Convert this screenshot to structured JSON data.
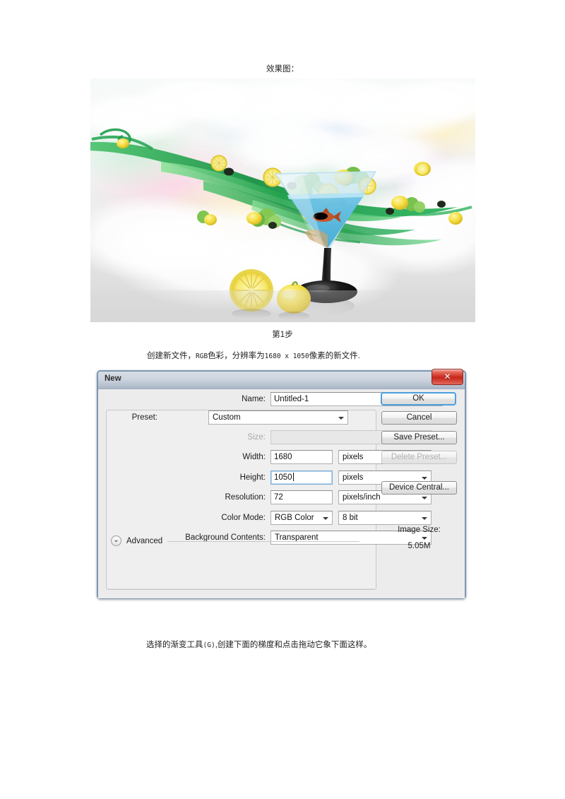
{
  "document": {
    "result_caption": "效果图：",
    "step_heading": "第1步",
    "step1_text_a": "创建新文件，",
    "step1_text_b": "RGB",
    "step1_text_c": "色彩，分辨率为",
    "step1_text_d": "1680 x 1050",
    "step1_text_e": "像素的新文件.",
    "step2_text_a": "选择的渐变工具",
    "step2_text_b": "(G)",
    "step2_text_c": ",创建下面的梯度和点击拖动它象下面这样。"
  },
  "artwork": {
    "alt": "抽象马提尼酒杯合成图：绿色丝带、柠檬片、生菜、金鱼在杯中，云彩与彩虹背景",
    "background_top": "#f7f9f8",
    "background_bottom": "#dddddd",
    "ribbon_color": "#189e4a",
    "lemon_color": "#f2e34a",
    "fish_color": "#c4562a",
    "glass_water": "#79c7e6"
  },
  "dialog": {
    "title": "New",
    "close_glyph": "✕",
    "fields": {
      "name_label": "Name:",
      "name_value": "Untitled-1",
      "preset_label": "Preset:",
      "preset_value": "Custom",
      "size_label": "Size:",
      "size_value": "",
      "width_label": "Width:",
      "width_value": "1680",
      "width_unit": "pixels",
      "height_label": "Height:",
      "height_value": "1050",
      "height_unit": "pixels",
      "resolution_label": "Resolution:",
      "resolution_value": "72",
      "resolution_unit": "pixels/inch",
      "color_mode_label": "Color Mode:",
      "color_mode_value": "RGB Color",
      "bit_depth_value": "8 bit",
      "background_contents_label": "Background Contents:",
      "background_contents_value": "Transparent",
      "advanced_label": "Advanced",
      "advanced_twisty": "⌄"
    },
    "buttons": {
      "ok": "OK",
      "cancel": "Cancel",
      "save_preset": "Save Preset...",
      "delete_preset": "Delete Preset...",
      "device_central": "Device Central..."
    },
    "image_size": {
      "label": "Image Size:",
      "value": "5.05M"
    },
    "colors": {
      "titlebar_top": "#d7dde5",
      "titlebar_bottom": "#aab6c6",
      "dialog_border": "#7d96b4",
      "close_red": "#c5261a",
      "focus_blue": "#4d9fe0",
      "body_gray": "#ececec"
    }
  }
}
